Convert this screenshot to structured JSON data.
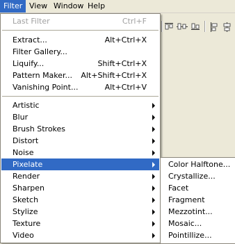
{
  "menubar": {
    "items": [
      "Filter",
      "View",
      "Window",
      "Help"
    ]
  },
  "toolbar": {
    "icons": [
      "align-top-edges-icon",
      "align-vertical-centers-icon",
      "align-bottom-edges-icon",
      "align-left-edges-icon",
      "align-horizontal-centers-icon"
    ]
  },
  "filter_menu": {
    "last_filter": {
      "label": "Last Filter",
      "shortcut": "Ctrl+F"
    },
    "group1": [
      {
        "label": "Extract...",
        "shortcut": "Alt+Ctrl+X"
      },
      {
        "label": "Filter Gallery...",
        "shortcut": ""
      },
      {
        "label": "Liquify...",
        "shortcut": "Shift+Ctrl+X"
      },
      {
        "label": "Pattern Maker...",
        "shortcut": "Alt+Shift+Ctrl+X"
      },
      {
        "label": "Vanishing Point...",
        "shortcut": "Alt+Ctrl+V"
      }
    ],
    "submenus": [
      "Artistic",
      "Blur",
      "Brush Strokes",
      "Distort",
      "Noise",
      "Pixelate",
      "Render",
      "Sharpen",
      "Sketch",
      "Stylize",
      "Texture",
      "Video"
    ],
    "highlighted": "Pixelate"
  },
  "pixelate_submenu": {
    "items": [
      "Color Halftone...",
      "Crystallize...",
      "Facet",
      "Fragment",
      "Mezzotint...",
      "Mosaic...",
      "Pointillize..."
    ]
  },
  "colors": {
    "highlight": "#316ac5",
    "menu_background": "#ffffff",
    "chrome": "#ece9d8",
    "disabled_text": "#a0a0a0"
  }
}
